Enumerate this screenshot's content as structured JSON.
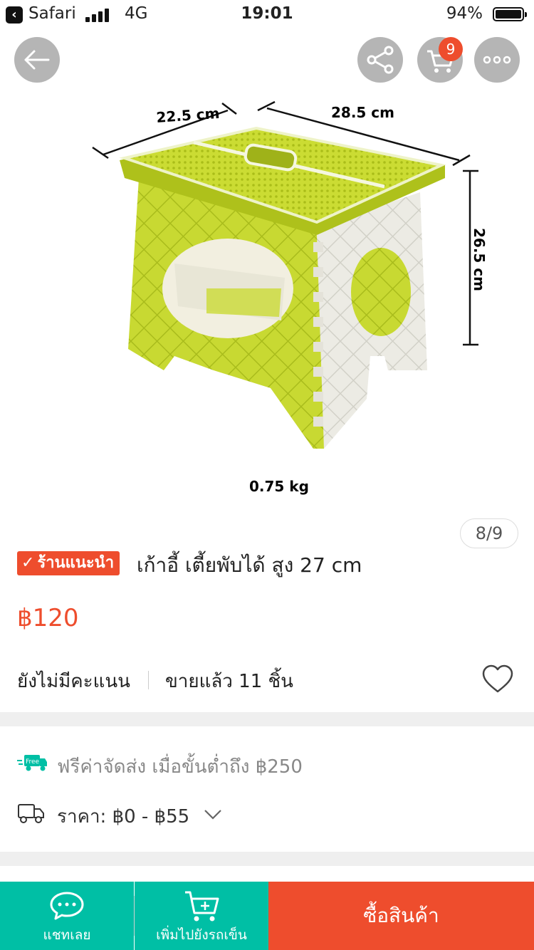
{
  "status_bar": {
    "app_name": "Safari",
    "network": "4G",
    "time": "19:01",
    "battery": "94%"
  },
  "image": {
    "dimension_width": "22.5 cm",
    "dimension_depth": "28.5 cm",
    "dimension_height": "26.5 cm",
    "weight": "0.75 kg",
    "pager": "8/9"
  },
  "header": {
    "cart_count": "9",
    "icons": [
      "back-arrow-icon",
      "share-icon",
      "cart-icon",
      "more-icon"
    ]
  },
  "product": {
    "badge": "ร้านแนะนำ",
    "title": "เก้าอี้ เตี้ยพับได้ สูง 27 cm",
    "price": "฿120",
    "rating_text": "ยังไม่มีคะแนน",
    "sold_text": "ขายแล้ว 11 ชิ้น"
  },
  "shipping": {
    "free_badge": "Free",
    "free_text": "ฟรีค่าจัดส่ง เมื่อขั้นต่ำถึง ฿250",
    "price_text": "ราคา: ฿0 - ฿55"
  },
  "bottom_bar": {
    "chat_label": "แชทเลย",
    "add_cart_label": "เพิ่มไปยังรถเข็น",
    "buy_label": "ซื้อสินค้า"
  },
  "colors": {
    "accent": "#ee4d2d",
    "teal": "#00bfa5",
    "stool_green": "#c5d82e"
  }
}
